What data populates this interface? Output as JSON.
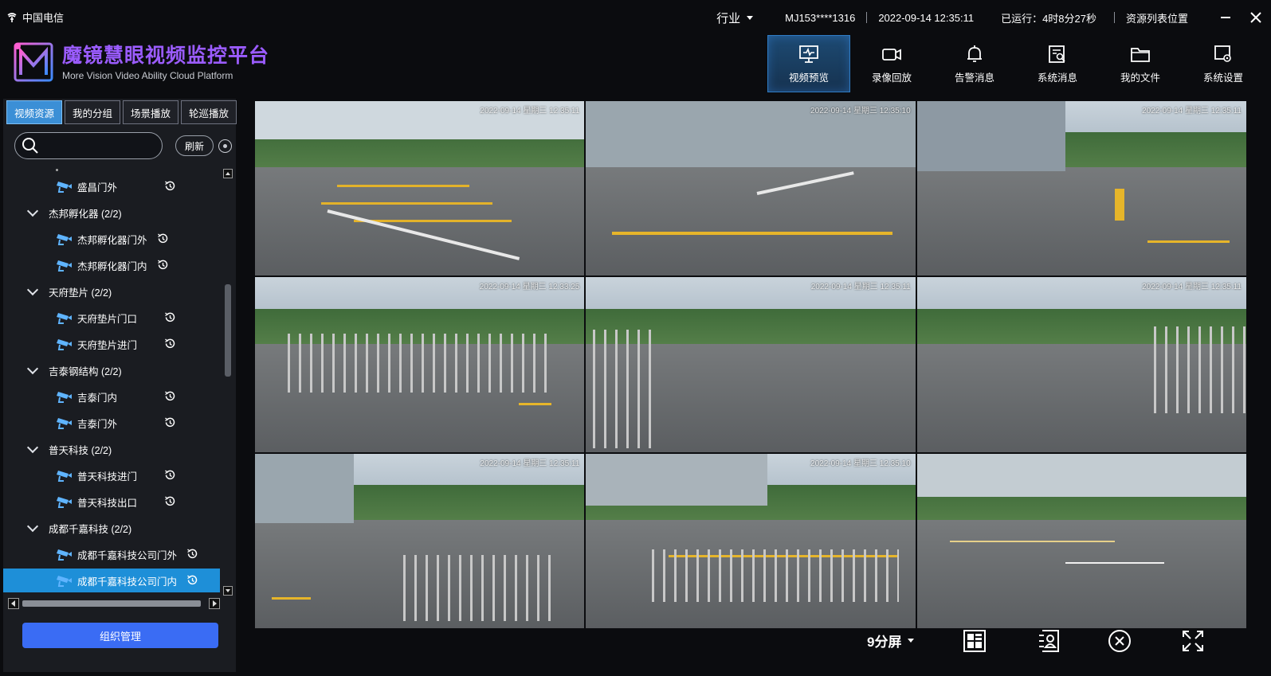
{
  "system_bar": {
    "carrier": "中国电信",
    "industry": "行业",
    "account": "MJ153****1316",
    "datetime": "2022-09-14 12:35:11",
    "runtime": "已运行：4时8分27秒",
    "resource_position": "资源列表位置"
  },
  "brand": {
    "title": "魔镜慧眼视频监控平台",
    "subtitle": "More Vision Video Ability Cloud Platform",
    "accent": "#9b5cff"
  },
  "nav": [
    {
      "label": "视频预览",
      "icon": "monitor-icon",
      "active": true
    },
    {
      "label": "录像回放",
      "icon": "video-camera-icon",
      "active": false
    },
    {
      "label": "告警消息",
      "icon": "bell-icon",
      "active": false
    },
    {
      "label": "系统消息",
      "icon": "message-search-icon",
      "active": false
    },
    {
      "label": "我的文件",
      "icon": "folder-icon",
      "active": false
    },
    {
      "label": "系统设置",
      "icon": "settings-icon",
      "active": false
    }
  ],
  "left_panel": {
    "tabs": [
      "视频资源",
      "我的分组",
      "场景播放",
      "轮巡播放"
    ],
    "active_tab": "视频资源",
    "search_placeholder": "",
    "refresh_label": "刷新",
    "org_button": "组织管理"
  },
  "tree": [
    {
      "type": "camera",
      "label": "盛昌门外"
    },
    {
      "type": "group",
      "label": "杰邦孵化器 (2/2)"
    },
    {
      "type": "camera",
      "label": "杰邦孵化器门外"
    },
    {
      "type": "camera",
      "label": "杰邦孵化器门内"
    },
    {
      "type": "group",
      "label": "天府垫片 (2/2)"
    },
    {
      "type": "camera",
      "label": "天府垫片门口"
    },
    {
      "type": "camera",
      "label": "天府垫片进门"
    },
    {
      "type": "group",
      "label": "吉泰钢结构 (2/2)"
    },
    {
      "type": "camera",
      "label": "吉泰门内"
    },
    {
      "type": "camera",
      "label": "吉泰门外"
    },
    {
      "type": "group",
      "label": "普天科技 (2/2)"
    },
    {
      "type": "camera",
      "label": "普天科技进门"
    },
    {
      "type": "camera",
      "label": "普天科技出口"
    },
    {
      "type": "group",
      "label": "成都千嘉科技 (2/2)"
    },
    {
      "type": "camera",
      "label": "成都千嘉科技公司门外"
    },
    {
      "type": "camera",
      "label": "成都千嘉科技公司门内",
      "selected": true
    }
  ],
  "video_tiles": [
    {
      "timestamp": "2022-09-14 星期三 12:35:11"
    },
    {
      "timestamp": "2022-09-14 星期三 12:35:10"
    },
    {
      "timestamp": "2022-09-14 星期三 12:35:11"
    },
    {
      "timestamp": "2022-09-14 星期三 12:33:25"
    },
    {
      "timestamp": "2022-09-14 星期三 12:35:11"
    },
    {
      "timestamp": "2022-09-14 星期三 12:35:11"
    },
    {
      "timestamp": "2022-09-14 星期三 12:35:11"
    },
    {
      "timestamp": "2022-09-14 星期三 12:35:10"
    },
    {
      "timestamp": ""
    }
  ],
  "toolbar": {
    "layout_label": "9分屏"
  },
  "colors": {
    "active_blue": "#1e8fd8",
    "org_button": "#3a6cf4",
    "panel_bg": "#1a1c21"
  }
}
